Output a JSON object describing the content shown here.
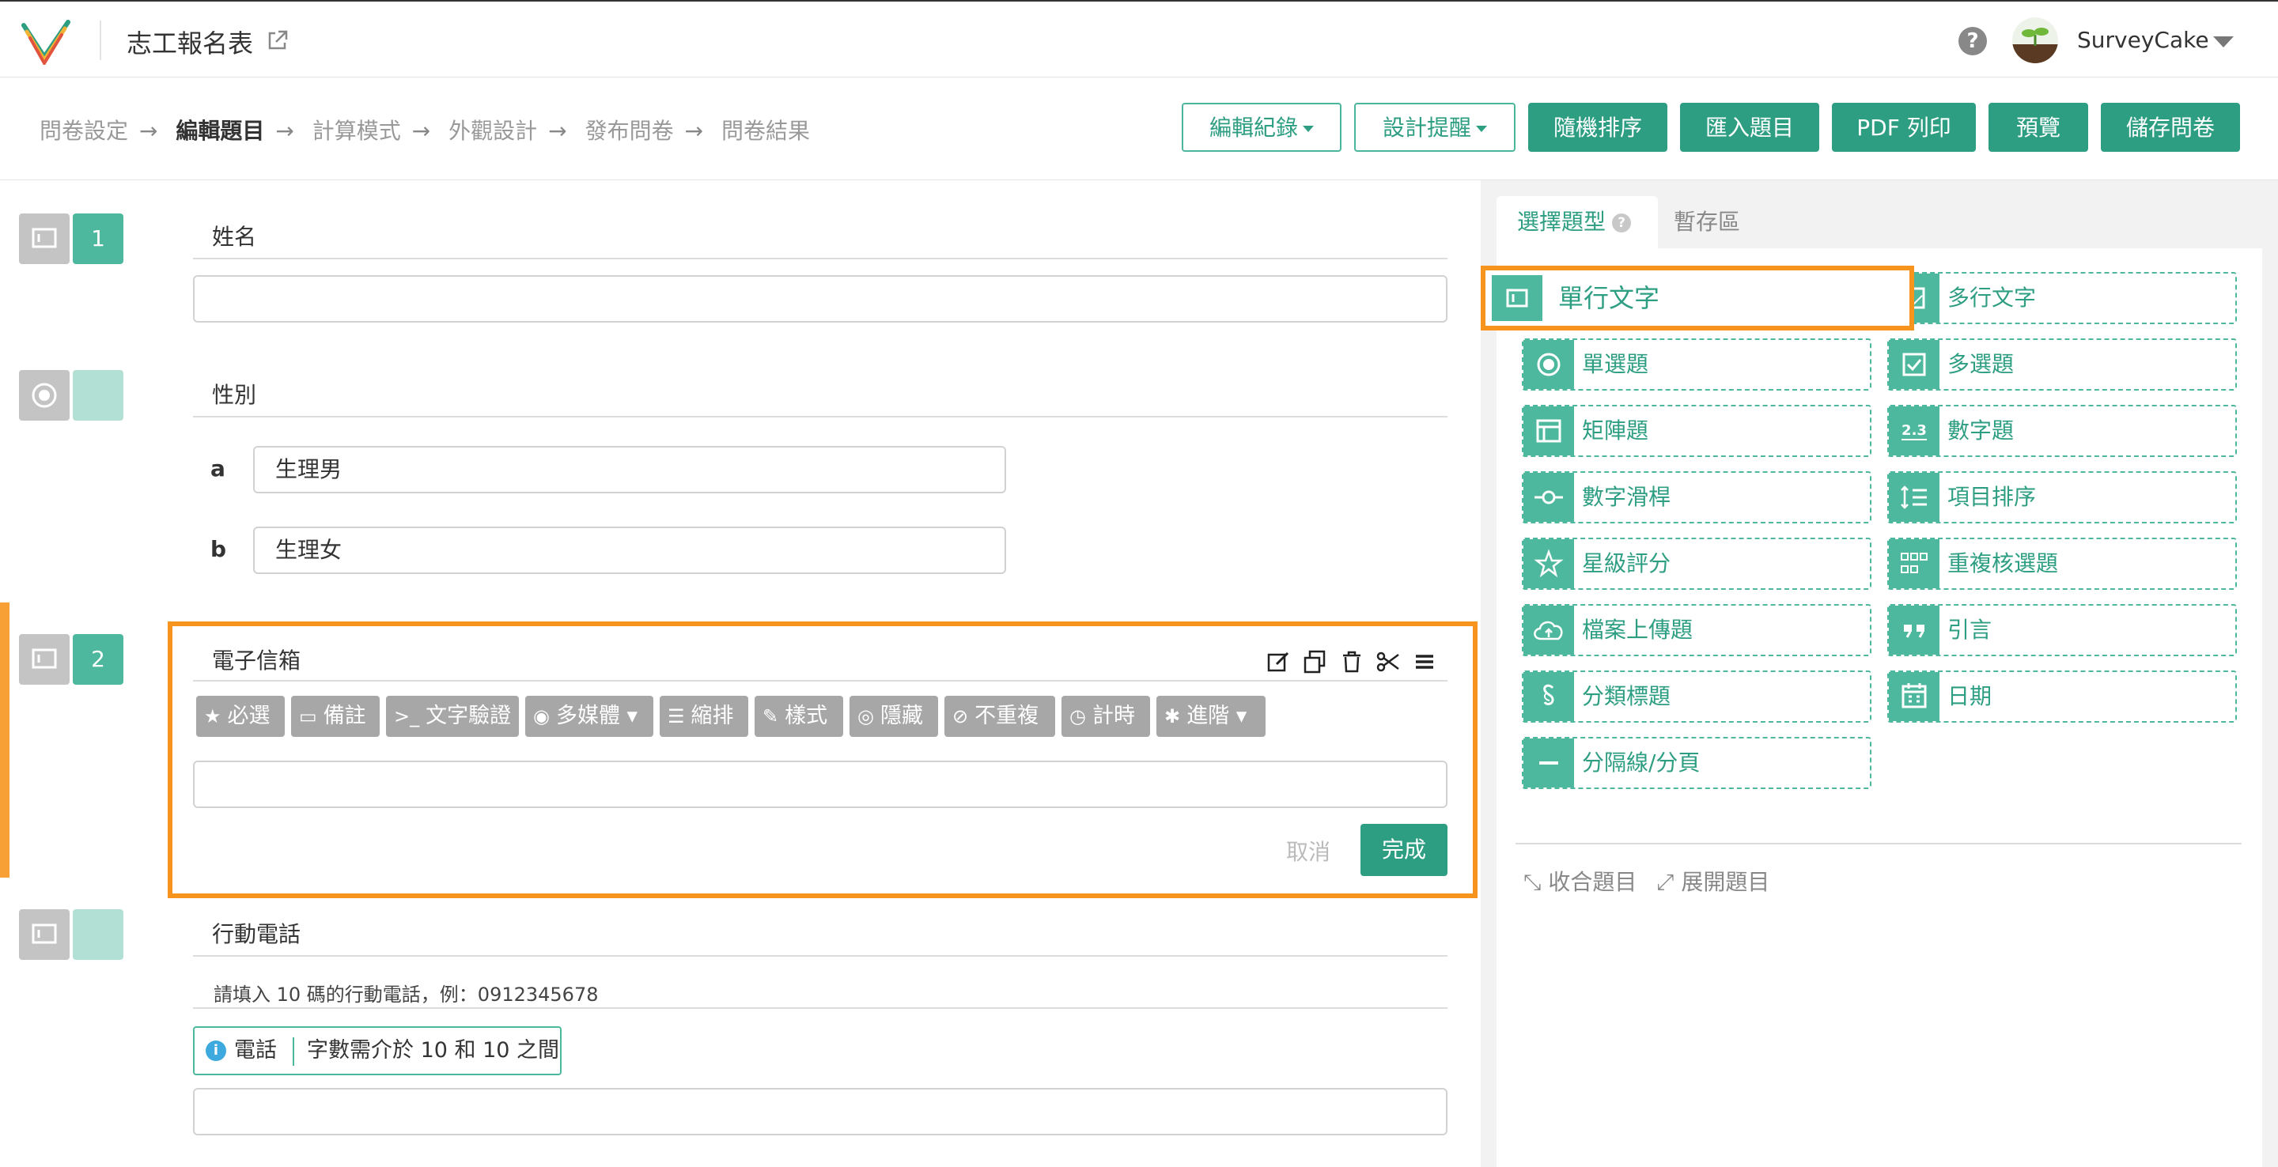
{
  "app": {
    "form_title": "志工報名表",
    "username": "SurveyCake",
    "accent_color": "#2e9e83",
    "highlight_color": "#f7941d"
  },
  "breadcrumbs": [
    "問卷設定",
    "編輯題目",
    "計算模式",
    "外觀設計",
    "發布問卷",
    "問卷結果"
  ],
  "breadcrumb_arrow": "→",
  "toolbar": {
    "edit_log": "編輯紀錄",
    "design_tips": "設計提醒",
    "random_order": "隨機排序",
    "import_questions": "匯入題目",
    "pdf_print": "PDF 列印",
    "preview": "預覽",
    "save": "儲存問卷"
  },
  "questions": [
    {
      "number": "1",
      "title": "姓名",
      "type_icon": "text-line-icon"
    },
    {
      "number": "",
      "title": "性別",
      "type_icon": "radio-icon",
      "options": [
        {
          "letter": "a",
          "value": "生理男"
        },
        {
          "letter": "b",
          "value": "生理女"
        }
      ]
    },
    {
      "number": "2",
      "title": "電子信箱",
      "type_icon": "text-line-icon",
      "chips": [
        "必選",
        "備註",
        "文字驗證",
        "多媒體",
        "縮排",
        "樣式",
        "隱藏",
        "不重複",
        "計時",
        "進階"
      ],
      "cancel": "取消",
      "done": "完成"
    },
    {
      "number": "",
      "title": "行動電話",
      "type_icon": "text-line-icon",
      "hint": "請填入 10 碼的行動電話，例：0912345678",
      "validation_label": "電話",
      "validation_msg": "字數需介於 10 和 10 之間"
    }
  ],
  "right_panel": {
    "tab_types": "選擇題型",
    "tab_drafts": "暫存區",
    "types": [
      "單行文字",
      "多行文字",
      "單選題",
      "多選題",
      "矩陣題",
      "數字題",
      "數字滑桿",
      "項目排序",
      "星級評分",
      "重複核選題",
      "檔案上傳題",
      "引言",
      "分類標題",
      "日期",
      "分隔線/分頁"
    ],
    "number_icon_text": "2.3",
    "collapse": "收合題目",
    "expand": "展開題目"
  }
}
